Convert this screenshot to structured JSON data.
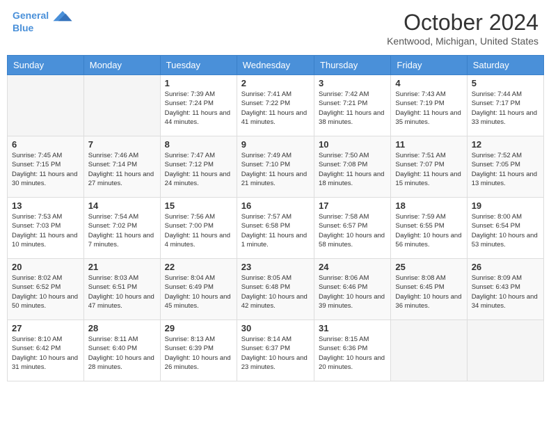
{
  "header": {
    "logo_line1": "General",
    "logo_line2": "Blue",
    "month": "October 2024",
    "location": "Kentwood, Michigan, United States"
  },
  "days_of_week": [
    "Sunday",
    "Monday",
    "Tuesday",
    "Wednesday",
    "Thursday",
    "Friday",
    "Saturday"
  ],
  "weeks": [
    [
      {
        "day": "",
        "sunrise": "",
        "sunset": "",
        "daylight": ""
      },
      {
        "day": "",
        "sunrise": "",
        "sunset": "",
        "daylight": ""
      },
      {
        "day": "1",
        "sunrise": "Sunrise: 7:39 AM",
        "sunset": "Sunset: 7:24 PM",
        "daylight": "Daylight: 11 hours and 44 minutes."
      },
      {
        "day": "2",
        "sunrise": "Sunrise: 7:41 AM",
        "sunset": "Sunset: 7:22 PM",
        "daylight": "Daylight: 11 hours and 41 minutes."
      },
      {
        "day": "3",
        "sunrise": "Sunrise: 7:42 AM",
        "sunset": "Sunset: 7:21 PM",
        "daylight": "Daylight: 11 hours and 38 minutes."
      },
      {
        "day": "4",
        "sunrise": "Sunrise: 7:43 AM",
        "sunset": "Sunset: 7:19 PM",
        "daylight": "Daylight: 11 hours and 35 minutes."
      },
      {
        "day": "5",
        "sunrise": "Sunrise: 7:44 AM",
        "sunset": "Sunset: 7:17 PM",
        "daylight": "Daylight: 11 hours and 33 minutes."
      }
    ],
    [
      {
        "day": "6",
        "sunrise": "Sunrise: 7:45 AM",
        "sunset": "Sunset: 7:15 PM",
        "daylight": "Daylight: 11 hours and 30 minutes."
      },
      {
        "day": "7",
        "sunrise": "Sunrise: 7:46 AM",
        "sunset": "Sunset: 7:14 PM",
        "daylight": "Daylight: 11 hours and 27 minutes."
      },
      {
        "day": "8",
        "sunrise": "Sunrise: 7:47 AM",
        "sunset": "Sunset: 7:12 PM",
        "daylight": "Daylight: 11 hours and 24 minutes."
      },
      {
        "day": "9",
        "sunrise": "Sunrise: 7:49 AM",
        "sunset": "Sunset: 7:10 PM",
        "daylight": "Daylight: 11 hours and 21 minutes."
      },
      {
        "day": "10",
        "sunrise": "Sunrise: 7:50 AM",
        "sunset": "Sunset: 7:08 PM",
        "daylight": "Daylight: 11 hours and 18 minutes."
      },
      {
        "day": "11",
        "sunrise": "Sunrise: 7:51 AM",
        "sunset": "Sunset: 7:07 PM",
        "daylight": "Daylight: 11 hours and 15 minutes."
      },
      {
        "day": "12",
        "sunrise": "Sunrise: 7:52 AM",
        "sunset": "Sunset: 7:05 PM",
        "daylight": "Daylight: 11 hours and 13 minutes."
      }
    ],
    [
      {
        "day": "13",
        "sunrise": "Sunrise: 7:53 AM",
        "sunset": "Sunset: 7:03 PM",
        "daylight": "Daylight: 11 hours and 10 minutes."
      },
      {
        "day": "14",
        "sunrise": "Sunrise: 7:54 AM",
        "sunset": "Sunset: 7:02 PM",
        "daylight": "Daylight: 11 hours and 7 minutes."
      },
      {
        "day": "15",
        "sunrise": "Sunrise: 7:56 AM",
        "sunset": "Sunset: 7:00 PM",
        "daylight": "Daylight: 11 hours and 4 minutes."
      },
      {
        "day": "16",
        "sunrise": "Sunrise: 7:57 AM",
        "sunset": "Sunset: 6:58 PM",
        "daylight": "Daylight: 11 hours and 1 minute."
      },
      {
        "day": "17",
        "sunrise": "Sunrise: 7:58 AM",
        "sunset": "Sunset: 6:57 PM",
        "daylight": "Daylight: 10 hours and 58 minutes."
      },
      {
        "day": "18",
        "sunrise": "Sunrise: 7:59 AM",
        "sunset": "Sunset: 6:55 PM",
        "daylight": "Daylight: 10 hours and 56 minutes."
      },
      {
        "day": "19",
        "sunrise": "Sunrise: 8:00 AM",
        "sunset": "Sunset: 6:54 PM",
        "daylight": "Daylight: 10 hours and 53 minutes."
      }
    ],
    [
      {
        "day": "20",
        "sunrise": "Sunrise: 8:02 AM",
        "sunset": "Sunset: 6:52 PM",
        "daylight": "Daylight: 10 hours and 50 minutes."
      },
      {
        "day": "21",
        "sunrise": "Sunrise: 8:03 AM",
        "sunset": "Sunset: 6:51 PM",
        "daylight": "Daylight: 10 hours and 47 minutes."
      },
      {
        "day": "22",
        "sunrise": "Sunrise: 8:04 AM",
        "sunset": "Sunset: 6:49 PM",
        "daylight": "Daylight: 10 hours and 45 minutes."
      },
      {
        "day": "23",
        "sunrise": "Sunrise: 8:05 AM",
        "sunset": "Sunset: 6:48 PM",
        "daylight": "Daylight: 10 hours and 42 minutes."
      },
      {
        "day": "24",
        "sunrise": "Sunrise: 8:06 AM",
        "sunset": "Sunset: 6:46 PM",
        "daylight": "Daylight: 10 hours and 39 minutes."
      },
      {
        "day": "25",
        "sunrise": "Sunrise: 8:08 AM",
        "sunset": "Sunset: 6:45 PM",
        "daylight": "Daylight: 10 hours and 36 minutes."
      },
      {
        "day": "26",
        "sunrise": "Sunrise: 8:09 AM",
        "sunset": "Sunset: 6:43 PM",
        "daylight": "Daylight: 10 hours and 34 minutes."
      }
    ],
    [
      {
        "day": "27",
        "sunrise": "Sunrise: 8:10 AM",
        "sunset": "Sunset: 6:42 PM",
        "daylight": "Daylight: 10 hours and 31 minutes."
      },
      {
        "day": "28",
        "sunrise": "Sunrise: 8:11 AM",
        "sunset": "Sunset: 6:40 PM",
        "daylight": "Daylight: 10 hours and 28 minutes."
      },
      {
        "day": "29",
        "sunrise": "Sunrise: 8:13 AM",
        "sunset": "Sunset: 6:39 PM",
        "daylight": "Daylight: 10 hours and 26 minutes."
      },
      {
        "day": "30",
        "sunrise": "Sunrise: 8:14 AM",
        "sunset": "Sunset: 6:37 PM",
        "daylight": "Daylight: 10 hours and 23 minutes."
      },
      {
        "day": "31",
        "sunrise": "Sunrise: 8:15 AM",
        "sunset": "Sunset: 6:36 PM",
        "daylight": "Daylight: 10 hours and 20 minutes."
      },
      {
        "day": "",
        "sunrise": "",
        "sunset": "",
        "daylight": ""
      },
      {
        "day": "",
        "sunrise": "",
        "sunset": "",
        "daylight": ""
      }
    ]
  ]
}
